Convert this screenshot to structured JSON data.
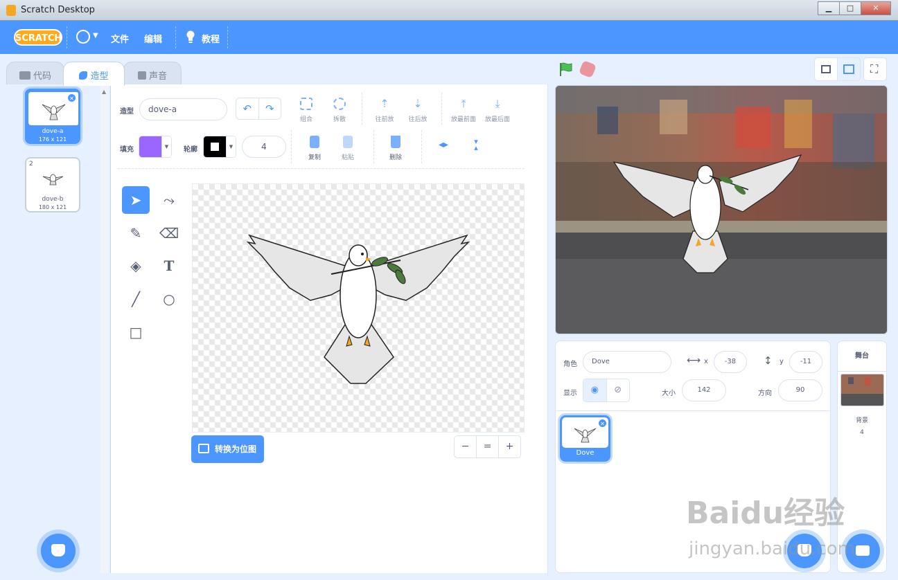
{
  "window": {
    "title": "Scratch Desktop",
    "btn_min": "▁",
    "btn_max": "□",
    "btn_close": "✕"
  },
  "menubar": {
    "logo": "SCRATCH",
    "file": "文件",
    "edit": "编辑",
    "tutorials": "教程",
    "icons": [
      "globe-icon",
      "lightbulb-icon"
    ]
  },
  "tabs": [
    {
      "label": "代码",
      "icon": "code-icon"
    },
    {
      "label": "造型",
      "icon": "brush-icon"
    },
    {
      "label": "声音",
      "icon": "speaker-icon"
    }
  ],
  "costumes": [
    {
      "index": "1",
      "name": "dove-a",
      "size": "176 x 121",
      "selected": true
    },
    {
      "index": "2",
      "name": "dove-b",
      "size": "180 x 121",
      "selected": false
    }
  ],
  "paint": {
    "costume_label": "造型",
    "costume_name": "dove-a",
    "fill_label": "填充",
    "fill_color": "#9966ff",
    "outline_label": "轮廓",
    "outline_color": "#000000",
    "outline_width": "4",
    "buttons": {
      "group": "组合",
      "ungroup": "拆散",
      "forward": "往前放",
      "backward": "往后放",
      "front": "放最前面",
      "back": "放最后面",
      "copy": "复制",
      "paste": "粘贴",
      "delete": "删除"
    },
    "convert": "转换为位图",
    "zoom": [
      "−",
      "=",
      "+"
    ],
    "tools": [
      "select-tool-icon",
      "reshape-tool-icon",
      "brush-tool-icon",
      "eraser-tool-icon",
      "fill-tool-icon",
      "text-tool-icon",
      "line-tool-icon",
      "circle-tool-icon",
      "rectangle-tool-icon"
    ]
  },
  "sprite": {
    "sprite_label": "角色",
    "name": "Dove",
    "x_label": "x",
    "x": "-38",
    "y_label": "y",
    "y": "-11",
    "show_label": "显示",
    "size_label": "大小",
    "size": "142",
    "direction_label": "方向",
    "direction": "90",
    "tile_name": "Dove"
  },
  "stage_panel": {
    "title": "舞台",
    "backdrop_label": "背景",
    "backdrop_count": "4"
  },
  "watermark": {
    "text": "Baidu经验",
    "sub": "jingyan.baidu.com"
  },
  "colors": {
    "accent": "#4c97ff",
    "menubar": "#4c97ff",
    "workspace": "#e6f0ff",
    "logo": "#ffab19",
    "flag": "#4cbf56",
    "stop": "#ec5959"
  }
}
